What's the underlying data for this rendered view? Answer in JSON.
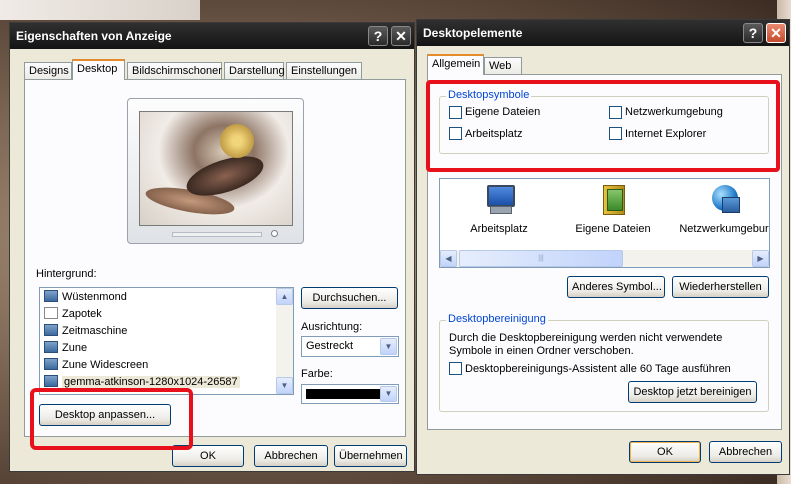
{
  "left_window": {
    "title": "Eigenschaften von Anzeige",
    "help_glyph": "?",
    "close_glyph": "✕",
    "tabs": [
      "Designs",
      "Desktop",
      "Bildschirmschoner",
      "Darstellung",
      "Einstellungen"
    ],
    "active_tab": "Desktop",
    "background_label": "Hintergrund:",
    "background_items": [
      "Wüstenmond",
      "Zapotek",
      "Zeitmaschine",
      "Zune",
      "Zune Widescreen",
      "gemma-atkinson-1280x1024-26587"
    ],
    "selected_background": "gemma-atkinson-1280x1024-26587",
    "browse_button": "Durchsuchen...",
    "position_label": "Ausrichtung:",
    "position_value": "Gestreckt",
    "color_label": "Farbe:",
    "color_value": "#000000",
    "customize_button": "Desktop anpassen...",
    "ok_button": "OK",
    "cancel_button": "Abbrechen",
    "apply_button": "Übernehmen"
  },
  "right_window": {
    "title": "Desktopelemente",
    "help_glyph": "?",
    "close_glyph": "✕",
    "tabs": [
      "Allgemein",
      "Web"
    ],
    "active_tab": "Allgemein",
    "icons_group_title": "Desktopsymbole",
    "checkboxes": {
      "my_documents": "Eigene Dateien",
      "my_computer": "Arbeitsplatz",
      "network": "Netzwerkumgebung",
      "ie": "Internet Explorer"
    },
    "icons": [
      {
        "label": "Arbeitsplatz",
        "icon": "computer-icon"
      },
      {
        "label": "Eigene Dateien",
        "icon": "documents-folder-icon"
      },
      {
        "label": "Netzwerkumgebur",
        "icon": "network-icon"
      }
    ],
    "change_icon_button": "Anderes Symbol...",
    "restore_button": "Wiederherstellen",
    "cleanup_group_title": "Desktopbereinigung",
    "cleanup_text_1": "Durch die Desktopbereinigung werden nicht verwendete",
    "cleanup_text_2": "Symbole in einen Ordner verschoben.",
    "cleanup_checkbox": "Desktopbereinigungs-Assistent alle 60 Tage ausführen",
    "cleanup_now_button": "Desktop jetzt bereinigen",
    "ok_button": "OK",
    "cancel_button": "Abbrechen"
  },
  "annotation_color": "#e8101a"
}
